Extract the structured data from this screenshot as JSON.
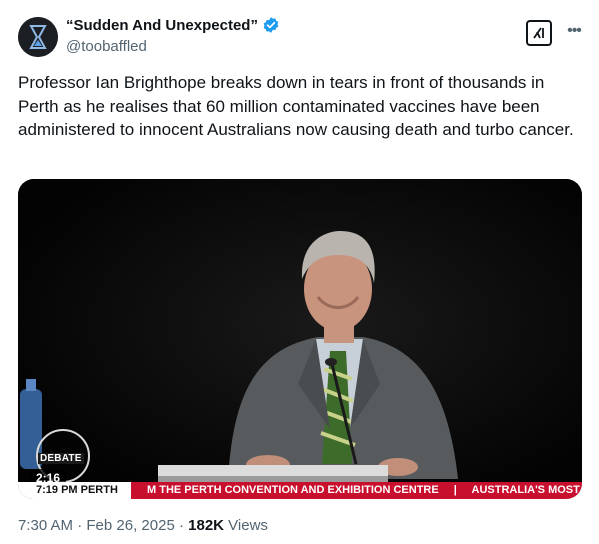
{
  "author": {
    "display_name": "“Sudden And Unexpected”",
    "handle": "@toobaffled",
    "verified": true
  },
  "tweet": {
    "text": "Professor Ian Brighthope breaks down in tears in front of thousands in Perth as he realises that 60 million contaminated vaccines have been administered to innocent Australians now causing death and turbo cancer."
  },
  "video": {
    "duration": "2:16",
    "overlay_logo_text": "DEBATE",
    "ticker_time": "7:19 PM PERTH",
    "ticker_text_1": "M THE PERTH CONVENTION AND EXHIBITION CENTRE",
    "ticker_separator": "|",
    "ticker_text_2": "AUSTRALIA'S MOST DI"
  },
  "meta": {
    "time": "7:30 AM",
    "date": "Feb 26, 2025",
    "separator": "·",
    "views_count": "182K",
    "views_label": "Views"
  },
  "icons": {
    "verified": "verified-badge-icon",
    "grok": "grok-icon",
    "more": "more-icon"
  },
  "colors": {
    "verified_blue": "#1d9bf0",
    "text_primary": "#0f1419",
    "text_secondary": "#536471",
    "ticker_red": "#c8102e"
  }
}
